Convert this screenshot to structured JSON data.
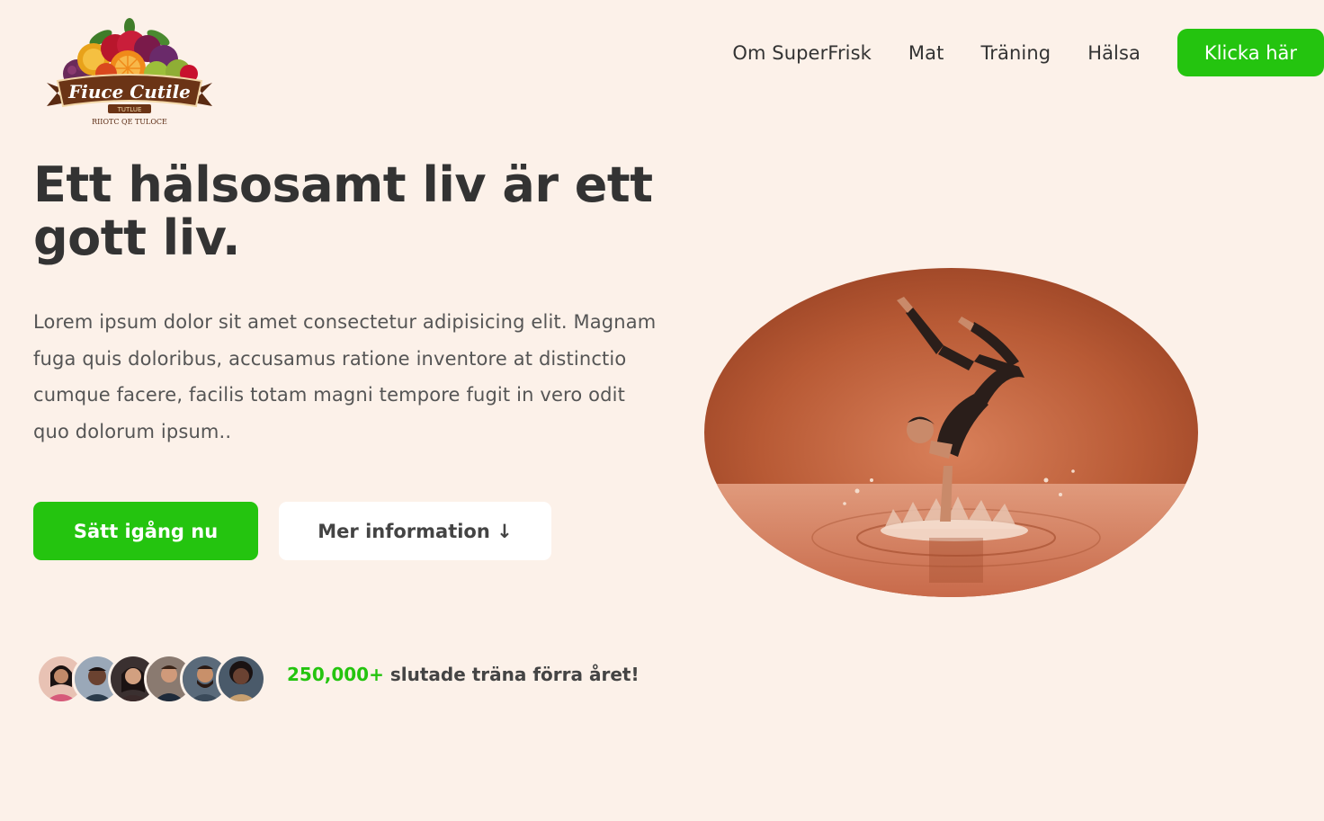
{
  "logo": {
    "banner_text": "Fiuce Cutile",
    "sub_text": "TUTLUE",
    "arc_text": "RIIOTC QE TULOCE"
  },
  "nav": {
    "items": [
      {
        "label": "Om SuperFrisk"
      },
      {
        "label": "Mat"
      },
      {
        "label": "Träning"
      },
      {
        "label": "Hälsa"
      }
    ],
    "cta_label": "Klicka här"
  },
  "hero": {
    "title": "Ett hälsosamt liv är ett gott liv.",
    "description": "Lorem ipsum dolor sit amet consectetur adipisicing elit. Magnam fuga quis doloribus, accusamus ratione inventore at distinctio cumque facere, facilis totam magni tempore fugit in vero odit quo dolorum ipsum..",
    "primary_button": "Sätt igång nu",
    "secondary_button": "Mer information ↓"
  },
  "social_proof": {
    "count": "250,000+",
    "text": " slutade träna förra året!"
  },
  "colors": {
    "background": "#fcf1e9",
    "accent_green": "#24c40f",
    "text_dark": "#333333",
    "text_body": "#555555"
  },
  "icons": {
    "logo": "fruit-basket-logo",
    "hero_image": "handstand-water-splash-photo",
    "avatars": [
      "user-avatar",
      "user-avatar",
      "user-avatar",
      "user-avatar",
      "user-avatar",
      "user-avatar"
    ]
  }
}
